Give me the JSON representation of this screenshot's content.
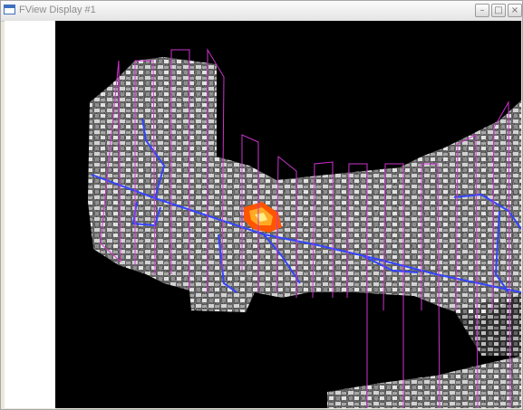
{
  "window": {
    "title": "FView Display #1",
    "controls": {
      "minimize_glyph": "–",
      "maximize_glyph": "□",
      "close_glyph": "×"
    }
  },
  "display": {
    "background_color": "#000000",
    "footprint_color": "#cc33cc",
    "road_color": "#3344ff",
    "hotspot_color": "#ff5500"
  }
}
